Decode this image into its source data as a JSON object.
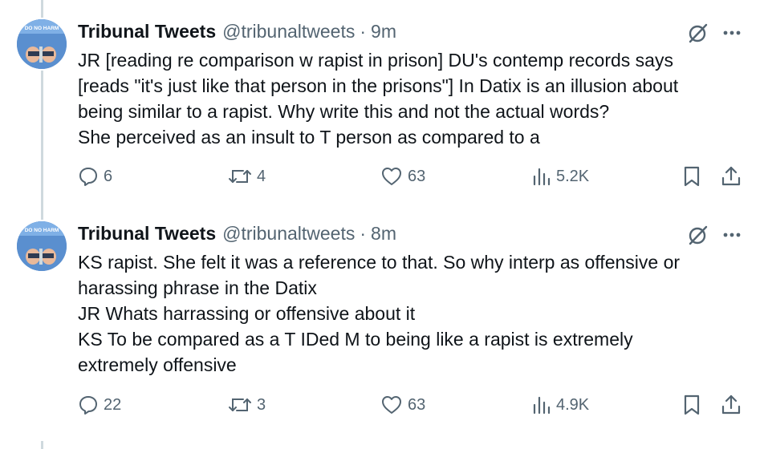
{
  "tweets": [
    {
      "author_name": "Tribunal Tweets",
      "handle": "@tribunaltweets",
      "separator": "·",
      "time": "9m",
      "avatar_text": "DO NO HARM",
      "lines": [
        "JR  [reading re comparison w rapist in prison] DU's contemp records says",
        "[reads \"it's just like that person in the  prisons\"] In Datix is an illusion about",
        "being similar to a rapist. Why write this and not the actual words?",
        "She perceived as an insult to T person as compared to a"
      ],
      "replies": "6",
      "reposts": "4",
      "likes": "63",
      "views": "5.2K"
    },
    {
      "author_name": "Tribunal Tweets",
      "handle": "@tribunaltweets",
      "separator": "·",
      "time": "8m",
      "avatar_text": "DO NO HARM",
      "lines": [
        "KS  rapist. She felt it was a reference to that. So why interp as offensive or",
        "harassing phrase in the Datix",
        "JR  Whats harrassing or offensive about it",
        "KS  To be compared as a T IDed M to being like a rapist is extremely",
        "extremely offensive"
      ],
      "replies": "22",
      "reposts": "3",
      "likes": "63",
      "views": "4.9K"
    }
  ],
  "colors": {
    "text": "#0f1419",
    "secondary": "#536471",
    "thread_line": "#cfd9de",
    "avatar_bg": "#5a8fcf"
  }
}
